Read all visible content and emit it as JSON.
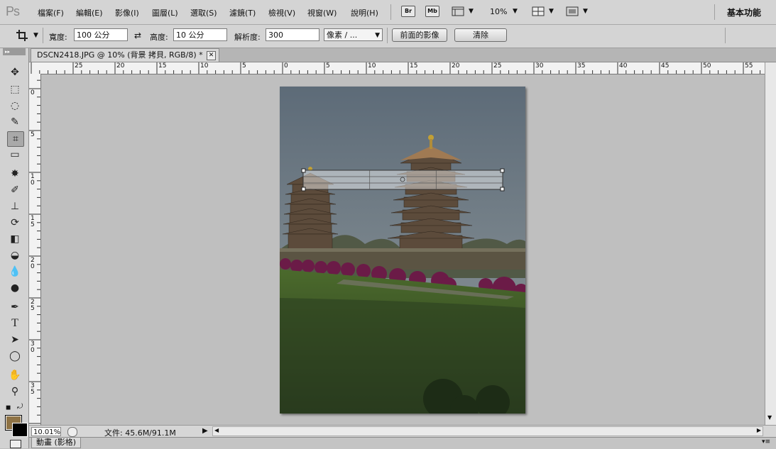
{
  "app": {
    "logo_text": "Ps"
  },
  "menu": {
    "items": [
      "檔案(F)",
      "編輯(E)",
      "影像(I)",
      "圖層(L)",
      "選取(S)",
      "濾鏡(T)",
      "檢視(V)",
      "視窗(W)",
      "說明(H)"
    ],
    "bridge_label": "Br",
    "minibridge_label": "Mb",
    "zoom_value": "10%",
    "workspace_label": "基本功能"
  },
  "options": {
    "width_label": "寬度:",
    "width_value": "100 公分",
    "height_label": "高度:",
    "height_value": "10 公分",
    "resolution_label": "解析度:",
    "resolution_value": "300",
    "unit_value": "像素 / ...",
    "front_image_button": "前面的影像",
    "clear_button": "清除"
  },
  "document": {
    "tab_title": "DSCN2418.JPG @ 10% (背景 拷貝, RGB/8) *",
    "close_glyph": "✕"
  },
  "rulers": {
    "top_labels": [
      "25",
      "20",
      "15",
      "10",
      "5",
      "0",
      "5",
      "10",
      "15",
      "20",
      "25",
      "30",
      "35",
      "40",
      "45",
      "50",
      "55"
    ],
    "left_labels": [
      "0",
      "5",
      "10",
      "15",
      "20",
      "25",
      "30",
      "35"
    ]
  },
  "status": {
    "zoom": "10.01%",
    "doc_info": "文件: 45.6M/91.1M"
  },
  "bottom_panel": {
    "tab_label": "動畫 (影格)"
  },
  "colors": {
    "foreground": "#8f7345",
    "background": "#000000"
  },
  "tools": [
    "move-tool-icon",
    "marquee-tool-icon",
    "lasso-tool-icon",
    "quick-selection-tool-icon",
    "crop-tool-icon",
    "eyedropper-tool-icon",
    "healing-brush-tool-icon",
    "brush-tool-icon",
    "clone-stamp-tool-icon",
    "history-brush-tool-icon",
    "eraser-tool-icon",
    "paint-bucket-tool-icon",
    "blur-tool-icon",
    "dodge-tool-icon",
    "pen-tool-icon",
    "type-tool-icon",
    "path-selection-tool-icon",
    "ellipse-tool-icon",
    "hand-tool-icon",
    "zoom-tool-icon"
  ]
}
